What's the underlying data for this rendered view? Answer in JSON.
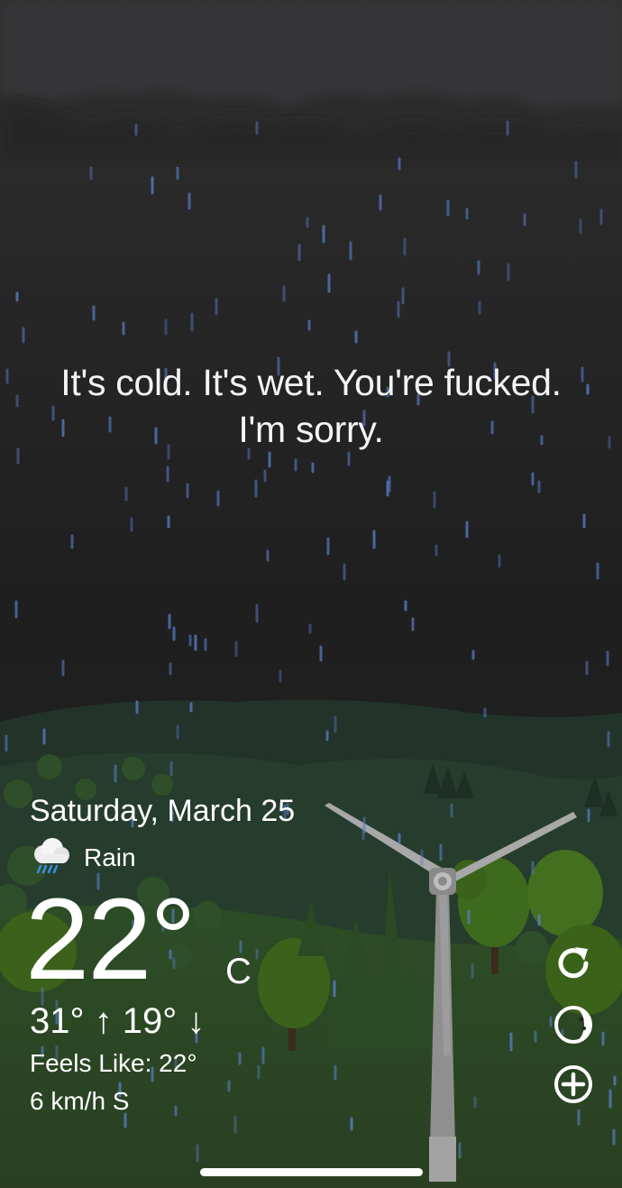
{
  "message": {
    "line1": "It's cold. It's wet. You're fucked.",
    "line2": "I'm sorry."
  },
  "weather": {
    "date": "Saturday, March 25",
    "condition": "Rain",
    "condition_icon": "rain-cloud-icon",
    "temperature": "22°",
    "unit": "C",
    "high_low": "31° ↑  19° ↓",
    "feels_like": "Feels Like: 22°",
    "wind": "6 km/h S"
  },
  "actions": {
    "refresh_icon": "refresh-icon",
    "theme_icon": "moon-phase-icon",
    "add_icon": "add-location-icon"
  },
  "colors": {
    "sky": "#1f1f20",
    "cloud": "#333334",
    "rain": "#5a7fc8",
    "hill": "#243a2c",
    "grass": "#2b4a25",
    "tree": "#3f6a1f",
    "turbine": "#9a9a9a"
  }
}
